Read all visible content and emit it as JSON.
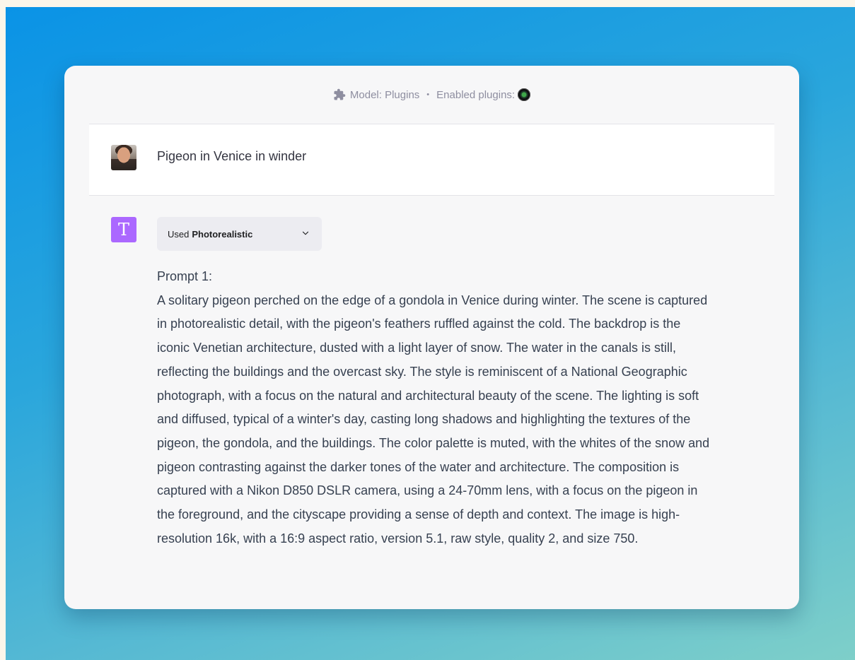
{
  "header": {
    "model_label": "Model: Plugins",
    "separator": "•",
    "enabled_label": "Enabled plugins:",
    "plugin_icon": "camera-lens-icon"
  },
  "user_message": {
    "text": "Pigeon in Venice in winder"
  },
  "assistant": {
    "avatar_letter": "T",
    "avatar_color": "#ab68ff",
    "plugin_used_prefix": "Used",
    "plugin_name": "Photorealistic",
    "prompt_title": "Prompt 1:",
    "prompt_body": "A solitary pigeon perched on the edge of a gondola in Venice during winter. The scene is captured in photorealistic detail, with the pigeon's feathers ruffled against the cold. The backdrop is the iconic Venetian architecture, dusted with a light layer of snow. The water in the canals is still, reflecting the buildings and the overcast sky. The style is reminiscent of a National Geographic photograph, with a focus on the natural and architectural beauty of the scene. The lighting is soft and diffused, typical of a winter's day, casting long shadows and highlighting the textures of the pigeon, the gondola, and the buildings. The color palette is muted, with the whites of the snow and pigeon contrasting against the darker tones of the water and architecture. The composition is captured with a Nikon D850 DSLR camera, using a 24-70mm lens, with a focus on the pigeon in the foreground, and the cityscape providing a sense of depth and context. The image is high-resolution 16k, with a 16:9 aspect ratio, version 5.1, raw style, quality 2, and size 750."
  }
}
